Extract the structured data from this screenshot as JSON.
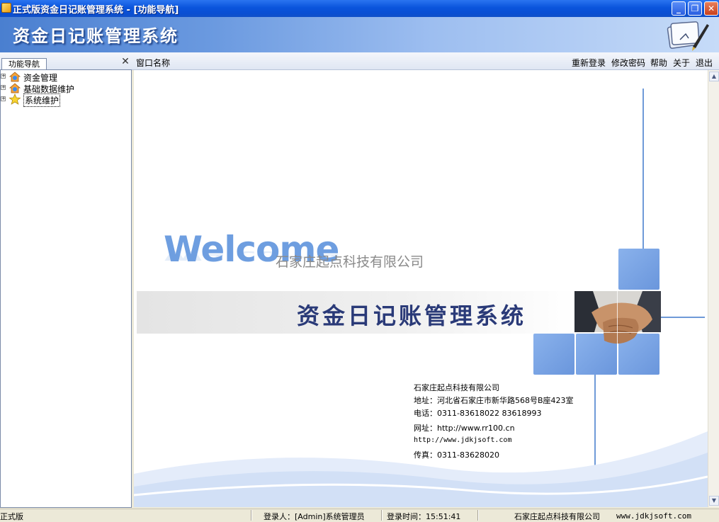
{
  "window": {
    "title": "正式版资金日记账管理系统 - [功能导航]",
    "controls": {
      "minimize": "_",
      "restore": "❐",
      "close": "✕"
    }
  },
  "banner": {
    "title": "资金日记账管理系统"
  },
  "command_bar": {
    "nav_tab": "功能导航",
    "window_name_label": "窗口名称",
    "links": [
      "重新登录",
      "修改密码",
      "帮助",
      "关于",
      "退出"
    ]
  },
  "tree": {
    "items": [
      {
        "label": "资金管理",
        "icon": "house-icon",
        "expander": "+"
      },
      {
        "label": "基础数据维护",
        "icon": "house-icon",
        "expander": "+"
      },
      {
        "label": "系统维护",
        "icon": "star-icon",
        "expander": "+",
        "selected": true
      }
    ]
  },
  "welcome": {
    "headline": "Welcome",
    "company_watermark": "石家庄起点科技有限公司",
    "system_title": "资金日记账管理系统",
    "info": {
      "company": "石家庄起点科技有限公司",
      "address": "地址：河北省石家庄市新华路568号B座423室",
      "phone": "电话：0311-83618022  83618993",
      "website": "网址：http://www.rr100.cn",
      "website2": "http://www.jdkjsoft.com",
      "fax": "传真：0311-83628020"
    }
  },
  "status_bar": {
    "edition": "正式版",
    "login_user": "登录人：[Admin]系统管理员",
    "login_time": "登录时间：15:51:41",
    "company": "石家庄起点科技有限公司",
    "website": "www.jdkjsoft.com"
  },
  "colors": {
    "title_bar": "#0a54dc",
    "banner_start": "#4a7fd0",
    "accent_blue": "#6f9ad8",
    "system_title": "#2a3a78"
  }
}
